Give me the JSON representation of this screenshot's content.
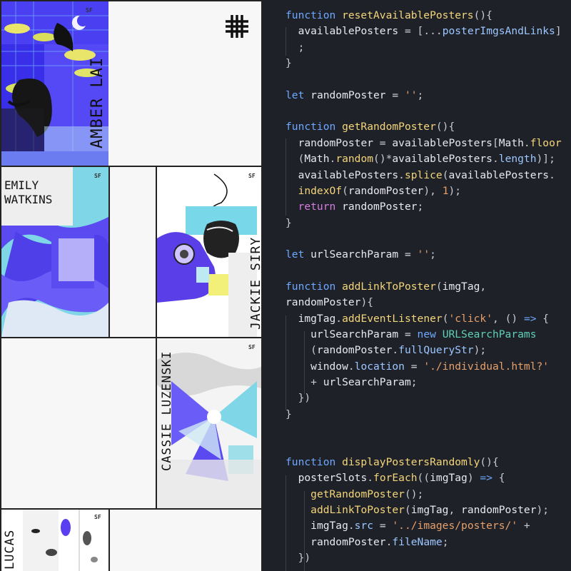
{
  "gallery": {
    "menu_icon": "hash-grid-icon",
    "posters": [
      {
        "name": "AMBER LAI",
        "slot": "top-left",
        "accent": "#3b2cf0"
      },
      {
        "name": "EMILY\nWATKINS",
        "slot": "middle-left",
        "accent": "#5b4df5"
      },
      {
        "name": "JACKIE SIRY",
        "slot": "middle-right",
        "accent": "#5237e6"
      },
      {
        "name": "CASSIE LUZENSKI",
        "slot": "lower-right",
        "accent": "#4a3ff0"
      },
      {
        "name": "LUCAS",
        "slot": "bottom-left",
        "accent": "#5a3ff0"
      }
    ],
    "poster_logo": "SF"
  },
  "editor": {
    "background": "#1f2128",
    "lines": [
      [
        [
          "t-kw",
          "function "
        ],
        [
          "t-fn",
          "resetAvailablePosters"
        ],
        [
          "t-pn",
          "(){"
        ]
      ],
      [
        [
          "t-pn",
          "  "
        ],
        [
          "t-id",
          "availablePosters"
        ],
        [
          "t-op",
          " = "
        ],
        [
          "t-pn",
          "[..."
        ],
        [
          "t-pr",
          "posterImgsAndLinks"
        ],
        [
          "t-pn",
          "]"
        ]
      ],
      [
        [
          "t-pn",
          "  ;"
        ]
      ],
      [
        [
          "t-pn",
          "}"
        ]
      ],
      [],
      [
        [
          "t-kw",
          "let "
        ],
        [
          "t-id",
          "randomPoster"
        ],
        [
          "t-op",
          " = "
        ],
        [
          "t-str",
          "''"
        ],
        [
          "t-pn",
          ";"
        ]
      ],
      [],
      [
        [
          "t-kw",
          "function "
        ],
        [
          "t-fn",
          "getRandomPoster"
        ],
        [
          "t-pn",
          "(){"
        ]
      ],
      [
        [
          "t-pn",
          "  "
        ],
        [
          "t-id",
          "randomPoster"
        ],
        [
          "t-op",
          " = "
        ],
        [
          "t-id",
          "availablePosters"
        ],
        [
          "t-pn",
          "["
        ],
        [
          "t-id",
          "Math"
        ],
        [
          "t-pn",
          "."
        ],
        [
          "t-fn",
          "floor"
        ]
      ],
      [
        [
          "t-pn",
          "  ("
        ],
        [
          "t-id",
          "Math"
        ],
        [
          "t-pn",
          "."
        ],
        [
          "t-fn",
          "random"
        ],
        [
          "t-pn",
          "()*"
        ],
        [
          "t-id",
          "availablePosters"
        ],
        [
          "t-pn",
          "."
        ],
        [
          "t-pr",
          "length"
        ],
        [
          "t-pn",
          ")];"
        ]
      ],
      [
        [
          "t-pn",
          "  "
        ],
        [
          "t-id",
          "availablePosters"
        ],
        [
          "t-pn",
          "."
        ],
        [
          "t-fn",
          "splice"
        ],
        [
          "t-pn",
          "("
        ],
        [
          "t-id",
          "availablePosters"
        ],
        [
          "t-pn",
          "."
        ]
      ],
      [
        [
          "t-pn",
          "  "
        ],
        [
          "t-fn",
          "indexOf"
        ],
        [
          "t-pn",
          "("
        ],
        [
          "t-id",
          "randomPoster"
        ],
        [
          "t-pn",
          "), "
        ],
        [
          "t-num",
          "1"
        ],
        [
          "t-pn",
          ");"
        ]
      ],
      [
        [
          "t-pn",
          "  "
        ],
        [
          "t-ret",
          "return "
        ],
        [
          "t-id",
          "randomPoster"
        ],
        [
          "t-pn",
          ";"
        ]
      ],
      [
        [
          "t-pn",
          "}"
        ]
      ],
      [],
      [
        [
          "t-kw",
          "let "
        ],
        [
          "t-id",
          "urlSearchParam"
        ],
        [
          "t-op",
          " = "
        ],
        [
          "t-str",
          "''"
        ],
        [
          "t-pn",
          ";"
        ]
      ],
      [],
      [
        [
          "t-kw",
          "function "
        ],
        [
          "t-fn",
          "addLinkToPoster"
        ],
        [
          "t-pn",
          "("
        ],
        [
          "t-id",
          "imgTag"
        ],
        [
          "t-pn",
          ","
        ]
      ],
      [
        [
          "t-id",
          "randomPoster"
        ],
        [
          "t-pn",
          "){"
        ]
      ],
      [
        [
          "t-pn",
          "  "
        ],
        [
          "t-id",
          "imgTag"
        ],
        [
          "t-pn",
          "."
        ],
        [
          "t-fn",
          "addEventListener"
        ],
        [
          "t-pn",
          "("
        ],
        [
          "t-str",
          "'click'"
        ],
        [
          "t-pn",
          ", () "
        ],
        [
          "t-kw",
          "=>"
        ],
        [
          "t-pn",
          " {"
        ]
      ],
      [
        [
          "t-pn",
          "    "
        ],
        [
          "t-id",
          "urlSearchParam"
        ],
        [
          "t-op",
          " = "
        ],
        [
          "t-kw",
          "new "
        ],
        [
          "t-cls",
          "URLSearchParams"
        ]
      ],
      [
        [
          "t-pn",
          "    ("
        ],
        [
          "t-id",
          "randomPoster"
        ],
        [
          "t-pn",
          "."
        ],
        [
          "t-pr",
          "fullQueryStr"
        ],
        [
          "t-pn",
          ");"
        ]
      ],
      [
        [
          "t-pn",
          "    "
        ],
        [
          "t-id",
          "window"
        ],
        [
          "t-pn",
          "."
        ],
        [
          "t-pr",
          "location"
        ],
        [
          "t-op",
          " = "
        ],
        [
          "t-str",
          "'./individual.html?'"
        ]
      ],
      [
        [
          "t-pn",
          "    + "
        ],
        [
          "t-id",
          "urlSearchParam"
        ],
        [
          "t-pn",
          ";"
        ]
      ],
      [
        [
          "t-pn",
          "  })"
        ]
      ],
      [
        [
          "t-pn",
          "}"
        ]
      ],
      [],
      [],
      [
        [
          "t-kw",
          "function "
        ],
        [
          "t-fn",
          "displayPostersRandomly"
        ],
        [
          "t-pn",
          "(){"
        ]
      ],
      [
        [
          "t-pn",
          "  "
        ],
        [
          "t-id",
          "posterSlots"
        ],
        [
          "t-pn",
          "."
        ],
        [
          "t-fn",
          "forEach"
        ],
        [
          "t-pn",
          "(("
        ],
        [
          "t-id",
          "imgTag"
        ],
        [
          "t-pn",
          ") "
        ],
        [
          "t-kw",
          "=>"
        ],
        [
          "t-pn",
          " {"
        ]
      ],
      [
        [
          "t-pn",
          "    "
        ],
        [
          "t-fn",
          "getRandomPoster"
        ],
        [
          "t-pn",
          "();"
        ]
      ],
      [
        [
          "t-pn",
          "    "
        ],
        [
          "t-fn",
          "addLinkToPoster"
        ],
        [
          "t-pn",
          "("
        ],
        [
          "t-id",
          "imgTag"
        ],
        [
          "t-pn",
          ", "
        ],
        [
          "t-id",
          "randomPoster"
        ],
        [
          "t-pn",
          ");"
        ]
      ],
      [
        [
          "t-pn",
          "    "
        ],
        [
          "t-id",
          "imgTag"
        ],
        [
          "t-pn",
          "."
        ],
        [
          "t-pr",
          "src"
        ],
        [
          "t-op",
          " = "
        ],
        [
          "t-str",
          "'../images/posters/'"
        ],
        [
          "t-pn",
          " +"
        ]
      ],
      [
        [
          "t-pn",
          "    "
        ],
        [
          "t-id",
          "randomPoster"
        ],
        [
          "t-pn",
          "."
        ],
        [
          "t-pr",
          "fileName"
        ],
        [
          "t-pn",
          ";"
        ]
      ],
      [
        [
          "t-pn",
          "  })"
        ]
      ]
    ]
  }
}
